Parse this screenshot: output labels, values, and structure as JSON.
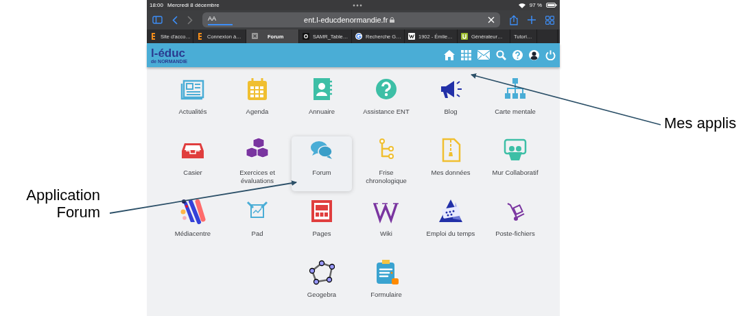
{
  "status_bar": {
    "time": "18:00",
    "date": "Mercredi 8 décembre",
    "battery": "97 %"
  },
  "address_bar": {
    "text_size": "AA",
    "url": "ent.l-educdenormandie.fr"
  },
  "tabs": [
    {
      "label": "Site d'acco…",
      "selected": false
    },
    {
      "label": "Connexion à…",
      "selected": false
    },
    {
      "label": "Forum",
      "selected": true
    },
    {
      "label": "SAMR_Table…",
      "selected": false
    },
    {
      "label": "Recherche G…",
      "selected": false
    },
    {
      "label": "1902 - Émile…",
      "selected": false
    },
    {
      "label": "Générateur…",
      "selected": false
    },
    {
      "label": "Tutori…",
      "selected": false
    }
  ],
  "logo": {
    "text": "l-éduc",
    "subtitle": "de NORMANDIE"
  },
  "apps": [
    {
      "label": "Actualités",
      "selected": false
    },
    {
      "label": "Agenda",
      "selected": false
    },
    {
      "label": "Annuaire",
      "selected": false
    },
    {
      "label": "Assistance ENT",
      "selected": false
    },
    {
      "label": "Blog",
      "selected": false
    },
    {
      "label": "Carte mentale",
      "selected": false
    },
    {
      "label": "Casier",
      "selected": false
    },
    {
      "label": "Exercices et évaluations",
      "selected": false
    },
    {
      "label": "Forum",
      "selected": true
    },
    {
      "label": "Frise chronologique",
      "selected": false
    },
    {
      "label": "Mes données",
      "selected": false
    },
    {
      "label": "Mur Collaboratif",
      "selected": false
    },
    {
      "label": "Médiacentre",
      "selected": false
    },
    {
      "label": "Pad",
      "selected": false
    },
    {
      "label": "Pages",
      "selected": false
    },
    {
      "label": "Wiki",
      "selected": false
    },
    {
      "label": "Emploi du temps",
      "selected": false
    },
    {
      "label": "Poste-fichiers",
      "selected": false
    },
    {
      "label": "Geogebra",
      "selected": false
    },
    {
      "label": "Formulaire",
      "selected": false
    }
  ],
  "annotations": [
    {
      "text": "Mes applis"
    },
    {
      "text": "Application Forum"
    }
  ]
}
